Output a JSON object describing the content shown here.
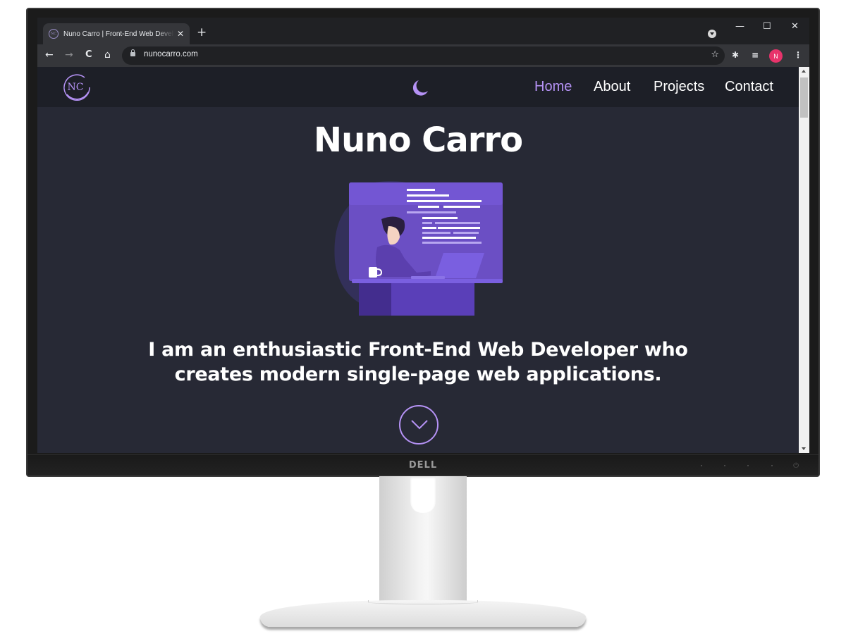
{
  "browser": {
    "tab_title": "Nuno Carro | Front-End Web Developer",
    "tab_close": "✕",
    "new_tab": "+",
    "window_controls": {
      "minimize": "—",
      "maximize": "☐",
      "close": "✕"
    },
    "nav": {
      "back": "←",
      "forward": "→",
      "reload": "C",
      "home": "⌂"
    },
    "url": "nunocarro.com",
    "profile_initial": "N",
    "bookmark_glyph": "☆",
    "extensions_glyph": "✱",
    "media_glyph": "≡",
    "menu_glyph": "⋮"
  },
  "site": {
    "logo_text": "NC",
    "theme_icon": "moon",
    "nav_links": [
      "Home",
      "About",
      "Projects",
      "Contact"
    ],
    "active_link": "Home",
    "hero_title": "Nuno Carro",
    "tagline_line1": "I am an enthusiastic Front-End Web Developer who",
    "tagline_line2": "creates modern single-page web applications."
  },
  "monitor": {
    "brand": "DELL",
    "power_glyph": "⏻"
  },
  "colors": {
    "accent": "#b592f5",
    "page_background": "#272935",
    "nav_background": "#1d1f27",
    "browser_chrome": "#35363a",
    "avatar": "#e8336b"
  }
}
